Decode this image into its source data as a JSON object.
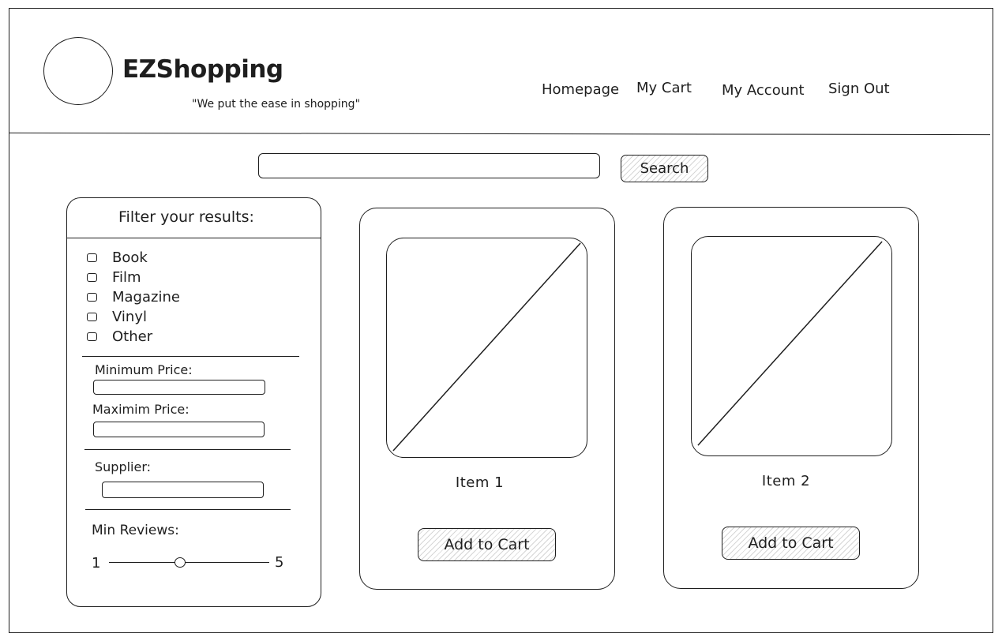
{
  "header": {
    "brand": "EZShopping",
    "tagline": "\"We put the ease in shopping\"",
    "nav": [
      "Homepage",
      "My Cart",
      "My Account",
      "Sign Out"
    ]
  },
  "search": {
    "value": "",
    "button_label": "Search"
  },
  "filters": {
    "title": "Filter your results:",
    "categories": [
      "Book",
      "Film",
      "Magazine",
      "Vinyl",
      "Other"
    ],
    "min_price_label": "Minimum Price:",
    "max_price_label": "Maximim Price:",
    "supplier_label": "Supplier:",
    "min_reviews_label": "Min Reviews:",
    "reviews_min": "1",
    "reviews_max": "5",
    "reviews_value": 2.8
  },
  "items": [
    {
      "title": "Item 1",
      "button_label": "Add to Cart"
    },
    {
      "title": "Item 2",
      "button_label": "Add to Cart"
    }
  ]
}
